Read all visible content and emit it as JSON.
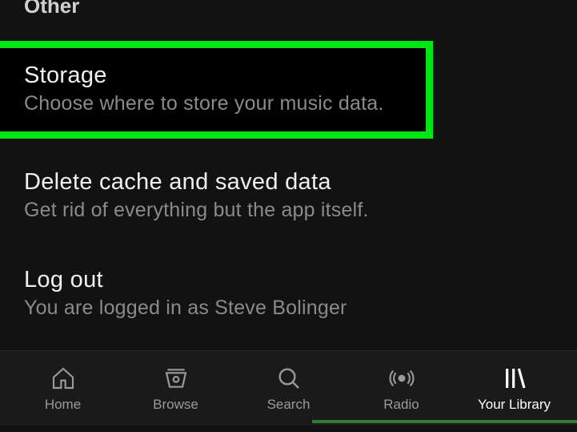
{
  "section_header": "Other",
  "settings": {
    "storage": {
      "title": "Storage",
      "subtitle": "Choose where to store your music data."
    },
    "delete_cache": {
      "title": "Delete cache and saved data",
      "subtitle": "Get rid of everything but the app itself."
    },
    "logout": {
      "title": "Log out",
      "subtitle": "You are logged in as Steve Bolinger"
    }
  },
  "nav": {
    "home": "Home",
    "browse": "Browse",
    "search": "Search",
    "radio": "Radio",
    "library": "Your Library"
  }
}
